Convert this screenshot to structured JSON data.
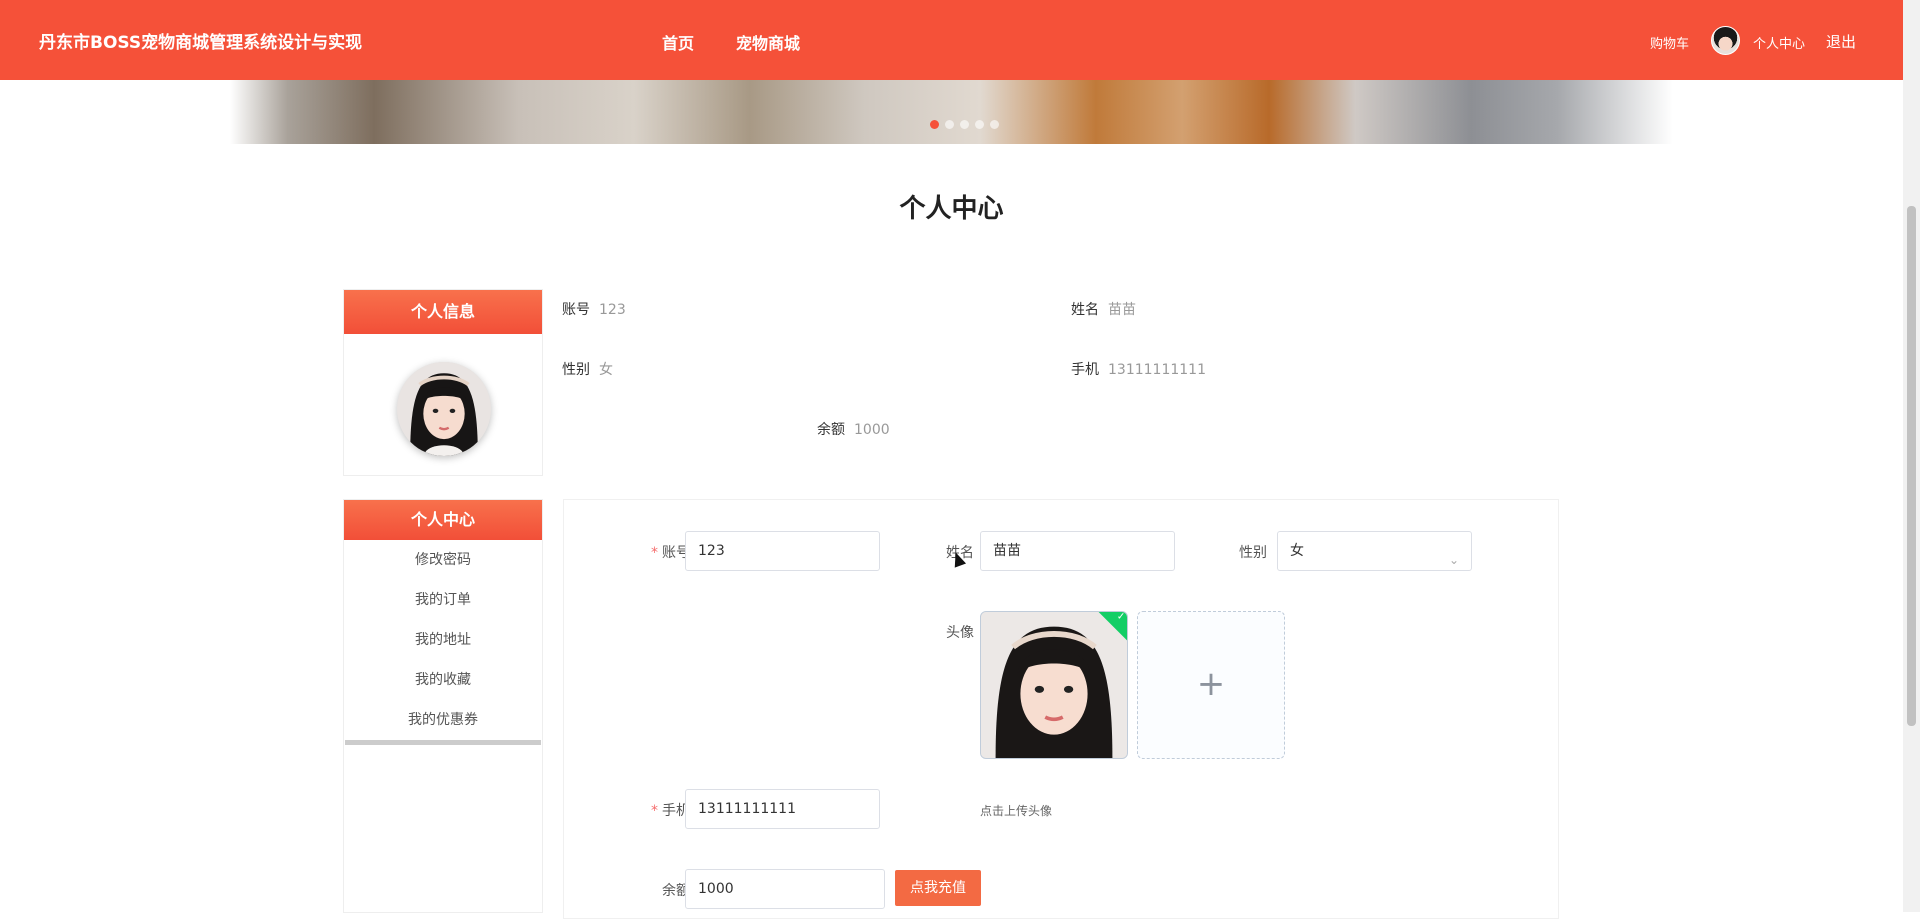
{
  "header": {
    "site_title": "丹东市BOSS宠物商城管理系统设计与实现",
    "nav": [
      "首页",
      "宠物商城"
    ],
    "cart": "购物车",
    "user_center": "个人中心",
    "logout": "退出"
  },
  "page_title": "个人中心",
  "profile_box": {
    "title": "个人信息"
  },
  "info": {
    "account_label": "账号",
    "account_value": "123",
    "name_label": "姓名",
    "name_value": "苗苗",
    "gender_label": "性别",
    "gender_value": "女",
    "phone_label": "手机",
    "phone_value": "13111111111",
    "balance_label": "余额",
    "balance_value": "1000"
  },
  "menu": {
    "title": "个人中心",
    "items": [
      "修改密码",
      "我的订单",
      "我的地址",
      "我的收藏",
      "我的优惠券"
    ]
  },
  "form": {
    "account_label": "账号",
    "account_value": "123",
    "name_label": "姓名",
    "name_value": "苗苗",
    "gender_label": "性别",
    "gender_value": "女",
    "avatar_label": "头像",
    "upload_tip": "点击上传头像",
    "phone_label": "手机",
    "phone_value": "13111111111",
    "balance_label": "余额",
    "balance_value": "1000",
    "recharge_button": "点我充值"
  },
  "colors": {
    "brand": "#f55139",
    "success": "#13ce66"
  },
  "icons": [
    "avatar",
    "chevron-down-icon",
    "plus-icon",
    "check-icon"
  ]
}
